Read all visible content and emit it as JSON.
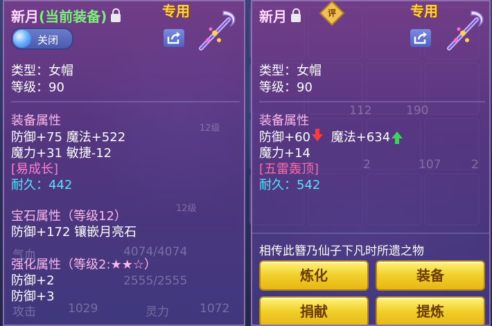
{
  "left_card": {
    "name": "新月",
    "state": "(当前装备)",
    "exclusive_label": "专用",
    "toggle_label": "关闭",
    "type_line": "类型：女帽",
    "level_line": "等级：90",
    "equip_attr_title": "装备属性",
    "attr_line1": "防御+75 魔法+522",
    "attr_line2": "魔力+31 敏捷-12",
    "special_tag": "[易成长]",
    "durability_line": "耐久：442",
    "gem_title": "宝石属性（等级12）",
    "gem_line": "防御+172 镶嵌月亮石",
    "enhance_title": "强化属性（等级2:★★☆）",
    "enhance_line1": "防御+2",
    "enhance_line2": "防御+3",
    "bg_faded_text": {
      "hp_label": "气血",
      "hp_value": "4074/4074",
      "mp_value": "2555/2555",
      "atk_label": "攻击",
      "atk_value": "1029",
      "spirit_label": "灵力",
      "spirit_value": "1072",
      "level_box_1": "12级",
      "level_box_2": "12级"
    }
  },
  "right_card": {
    "name": "新月",
    "eval_badge": "评",
    "exclusive_label": "专用",
    "type_line": "类型：女帽",
    "level_line": "等级：90",
    "equip_attr_title": "装备属性",
    "attr_defense": "防御+60",
    "attr_magic": "魔法+634",
    "attr_line2": "魔力+14",
    "special_tag": "[五雷轰顶]",
    "durability_line": "耐久：542",
    "description": "相传此簪乃仙子下凡时所遗之物",
    "buttons": {
      "refine": "炼化",
      "equip": "装备",
      "donate": "捐献",
      "extract": "提炼"
    },
    "bg_faded_numbers": [
      "112",
      "190",
      "2",
      "107",
      "2"
    ]
  },
  "colors": {
    "title_state": "#7df07a",
    "section_title": "#ffb7e8",
    "durability": "#55e3ff",
    "special_tag": "#ff7ed2",
    "exclusive": "#ffd34d",
    "button_gold": "#f1cf2a"
  },
  "icons": [
    "lock-icon",
    "share-icon",
    "hairpin-icon",
    "arrow-down-icon",
    "arrow-up-icon",
    "eval-badge-icon"
  ]
}
